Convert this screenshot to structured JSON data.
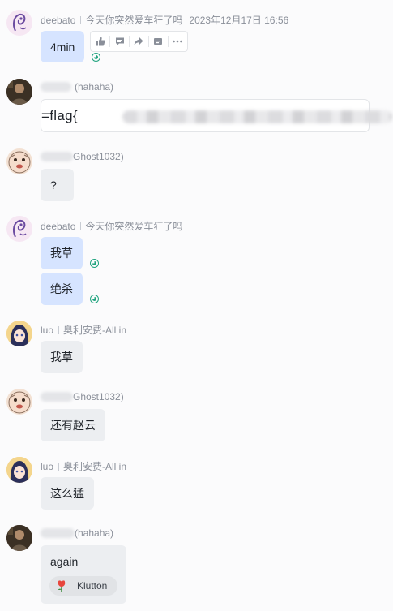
{
  "messages": [
    {
      "sender": "deebato",
      "group": "今天你突然爱车狂了吗",
      "timestamp": "2023年12月17日 16:56",
      "text": "4min"
    },
    {
      "sender": "(hahaha)",
      "text": "=flag{"
    },
    {
      "sender": "Ghost1032)",
      "text": "?"
    },
    {
      "sender": "deebato",
      "group": "今天你突然爱车狂了吗",
      "texts": [
        "我草",
        "绝杀"
      ]
    },
    {
      "sender": "luo",
      "group": "奥利安费-All in",
      "text": "我草"
    },
    {
      "sender": "Ghost1032)",
      "text": "还有赵云"
    },
    {
      "sender": "luo",
      "group": "奥利安费-All in",
      "text": "这么猛"
    },
    {
      "sender": "(hahaha)",
      "text": "again",
      "reaction": {
        "icon": "rose-icon",
        "label": "Klutton"
      }
    }
  ],
  "toolbar": {
    "icons": [
      "thumbs-up-icon",
      "comment-icon",
      "forward-icon",
      "card-icon",
      "more-icon"
    ]
  },
  "colors": {
    "self_bubble": "#d6e4ff",
    "other_bubble": "#eceef1",
    "read_indicator": "#1fa37e",
    "meta_text": "#8a8f99"
  }
}
